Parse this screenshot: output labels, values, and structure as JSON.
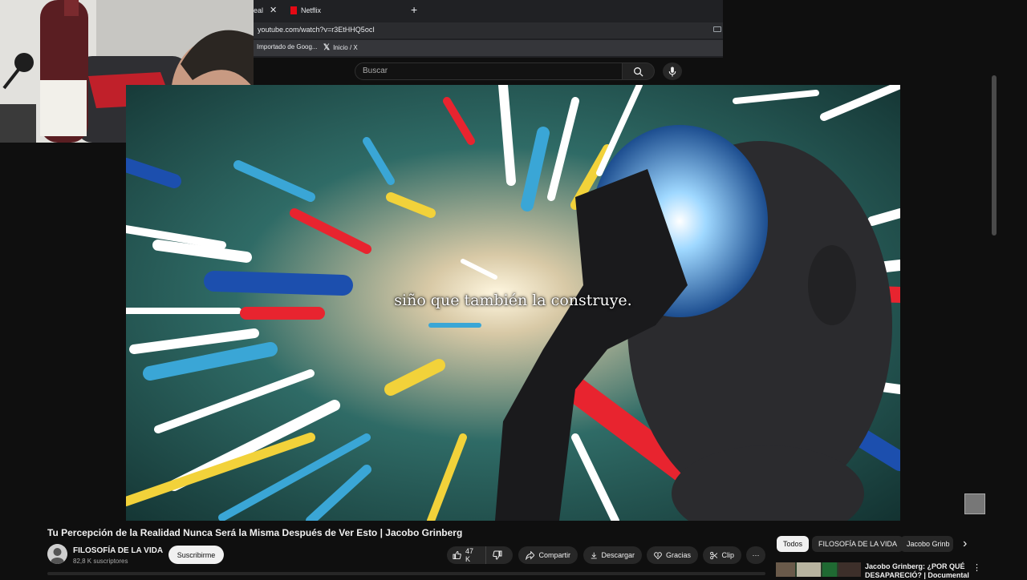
{
  "browser": {
    "tabs": [
      {
        "label": "eal",
        "close": "✕"
      },
      {
        "label": "Netflix"
      }
    ],
    "new_tab": "+",
    "url": "youtube.com/watch?v=r3EtHHQ5ocI",
    "bookmarks": [
      {
        "label": "Importado de Goog..."
      },
      {
        "label": "Inicio / X"
      }
    ]
  },
  "masthead": {
    "search_placeholder": "Buscar"
  },
  "video": {
    "caption": "siño que también la construye."
  },
  "details": {
    "title": "Tu Percepción de la Realidad Nunca Será la Misma Después de Ver Esto | Jacobo Grinberg",
    "channel_name": "FILOSOFÍA DE LA VIDA",
    "subscribers": "82,8 K suscriptores",
    "subscribe_label": "Suscribirme",
    "like_count": "47 K",
    "share_label": "Compartir",
    "download_label": "Descargar",
    "thanks_label": "Gracias",
    "clip_label": "Clip",
    "more_label": "⋯"
  },
  "sidebar": {
    "chips": [
      "Todos",
      "FILOSOFÍA DE LA VIDA",
      "Jacobo Grinb"
    ],
    "next_arrow": "›",
    "recommendation": {
      "title": "Jacobo Grinberg: ¿POR QUÉ DESAPARECIÓ? | Documental"
    }
  },
  "colors": {
    "background": "#0f0f0f",
    "netflix": "#e50914",
    "pill": "#272727",
    "subscribe_bg": "#f1f1f1"
  }
}
